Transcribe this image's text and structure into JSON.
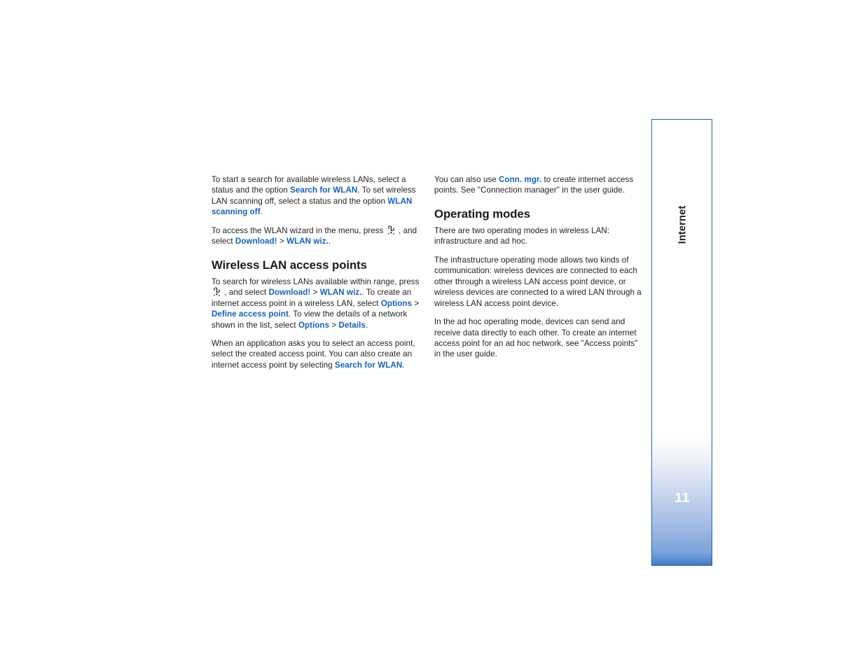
{
  "document": {
    "title": "Internet",
    "page_number": "11",
    "sidebar_tab_label": "Internet",
    "accent_color": "#1161c4",
    "tab_border_color": "#1f64ae",
    "tab_gradient_end_color": "#2b6ec2"
  },
  "left_column": {
    "paragraph_1": {
      "t1": "To start a search for available wireless LANs, select a status and the option ",
      "link1": "Search for WLAN",
      "t2": ". To set wireless LAN scanning off, select a status and the option ",
      "link2": "WLAN scanning off",
      "t3": "."
    },
    "paragraph_2": {
      "t1": "To access the WLAN wizard in the menu, press ",
      "icon": "menu-key-icon",
      "t2": " , and select ",
      "link1": "Download!",
      "gt": " > ",
      "link2": "WLAN wiz.",
      "t3": "."
    },
    "heading_1": "Wireless LAN access points",
    "paragraph_3": {
      "t1": "To search for wireless LANs available within range, press ",
      "icon": "menu-key-icon",
      "t2": " , and select ",
      "link1": "Download!",
      "gt1": " > ",
      "link2": "WLAN wiz.",
      "t3": ". To create an internet access point in a wireless LAN, select ",
      "link3": "Options",
      "gt2": " > ",
      "link4": "Define access point",
      "t4": ". To view the details of a network shown in the list, select ",
      "link5": "Options",
      "gt3": " > ",
      "link6": "Details",
      "t5": "."
    },
    "paragraph_4": {
      "t1": "When an application asks you to select an access point, select the created access point. You can also create an internet access point by selecting ",
      "link1": "Search for WLAN",
      "t2": "."
    }
  },
  "right_column": {
    "paragraph_1": {
      "t1": "You can also use ",
      "link1": "Conn. mgr.",
      "t2": " to create internet access points. See \"Connection manager\" in the user guide."
    },
    "heading_1": "Operating modes",
    "paragraph_2": "There are two operating modes in wireless LAN: infrastructure and ad hoc.",
    "paragraph_3": "The infrastructure operating mode allows two kinds of communication: wireless devices are connected to each other through a wireless LAN access point device, or wireless devices are connected to a wired LAN through a wireless LAN access point device.",
    "paragraph_4": "In the ad hoc operating mode, devices can send and receive data directly to each other. To create an internet access point for an ad hoc network, see \"Access points\" in the user guide."
  }
}
